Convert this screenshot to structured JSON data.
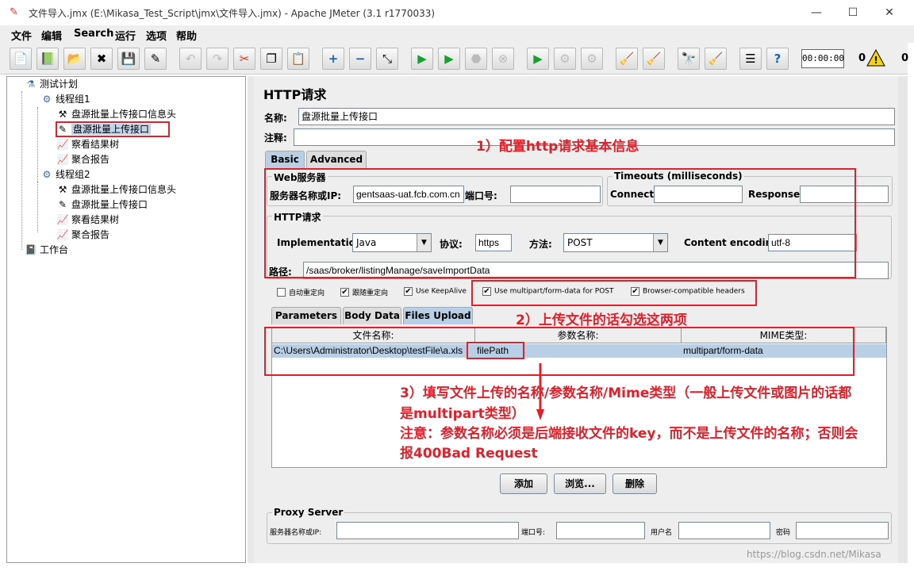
{
  "window": {
    "title": "文件导入.jmx (E:\\Mikasa_Test_Script\\jmx\\文件导入.jmx) - Apache JMeter (3.1 r1770033)",
    "minimize": "—",
    "maximize": "☐",
    "close": "✕"
  },
  "menu": [
    "文件",
    "编辑",
    "Search",
    "运行",
    "选项",
    "帮助"
  ],
  "toolbar": {
    "timer": "00:00:00",
    "warn_count": "0",
    "thread_count": "0"
  },
  "tree": [
    {
      "label": "测试计划",
      "icon": "flask-icon"
    },
    {
      "label": "线程组1",
      "icon": "gear-icon"
    },
    {
      "label": "盘源批量上传接口信息头",
      "icon": "wrench-icon"
    },
    {
      "label": "盘源批量上传接口",
      "icon": "pipette-icon"
    },
    {
      "label": "察看结果树",
      "icon": "graph-icon"
    },
    {
      "label": "聚合报告",
      "icon": "graph-icon"
    },
    {
      "label": "线程组2",
      "icon": "gear-icon"
    },
    {
      "label": "盘源批量上传接口信息头",
      "icon": "wrench-icon"
    },
    {
      "label": "盘源批量上传接口",
      "icon": "pipette-icon"
    },
    {
      "label": "察看结果树",
      "icon": "graph-icon"
    },
    {
      "label": "聚合报告",
      "icon": "graph-icon"
    },
    {
      "label": "工作台",
      "icon": "workbench-icon"
    }
  ],
  "panel": {
    "header": "HTTP请求",
    "name_label": "名称:",
    "name_value": "盘源批量上传接口",
    "comment_label": "注释:",
    "comment_value": "",
    "tabs": [
      "Basic",
      "Advanced"
    ],
    "web_server_title": "Web服务器",
    "server_label": "服务器名称或IP:",
    "server_value": "gentsaas-uat.fcb.com.cn",
    "port_label": "端口号:",
    "port_value": "",
    "timeouts_title": "Timeouts (milliseconds)",
    "connect_label": "Connect:",
    "connect_value": "",
    "response_label": "Response:",
    "response_value": "",
    "http_title": "HTTP请求",
    "impl_label": "Implementation:",
    "impl_value": "Java",
    "protocol_label": "协议:",
    "protocol_value": "https",
    "method_label": "方法:",
    "method_value": "POST",
    "encoding_label": "Content encoding:",
    "encoding_value": "utf-8",
    "path_label": "路径:",
    "path_value": "/saas/broker/listingManage/saveImportData",
    "checkboxes": [
      {
        "label": "自动重定向",
        "checked": false
      },
      {
        "label": "跟随重定向",
        "checked": true
      },
      {
        "label": "Use KeepAlive",
        "checked": true
      },
      {
        "label": "Use multipart/form-data for POST",
        "checked": true
      },
      {
        "label": "Browser-compatible headers",
        "checked": true
      }
    ],
    "subtabs": [
      "Parameters",
      "Body Data",
      "Files Upload"
    ],
    "table_headers": [
      "文件名称:",
      "参数名称:",
      "MIME类型:"
    ],
    "table_row": [
      "C:\\Users\\Administrator\\Desktop\\testFile\\a.xls",
      "filePath",
      "multipart/form-data"
    ],
    "buttons": [
      "添加",
      "浏览...",
      "删除"
    ],
    "proxy_title": "Proxy Server",
    "proxy_server_label": "服务器名称或IP:",
    "proxy_port_label": "端口号:",
    "proxy_user_label": "用户名",
    "proxy_pass_label": "密码"
  },
  "annotations": {
    "a1": "1）配置http请求基本信息",
    "a2": "2）上传文件的话勾选这两项",
    "a3_line1": "3）填写文件上传的名称/参数名称/Mime类型（一般上传文件或图片的话都",
    "a3_line2": "是multipart类型）",
    "a3_line3": "注意：参数名称必须是后端接收文件的key，而不是上传文件的名称；否则会",
    "a3_line4": "报400Bad Request",
    "color": "#e0202a"
  },
  "watermark": "https://blog.csdn.net/Mikasa"
}
